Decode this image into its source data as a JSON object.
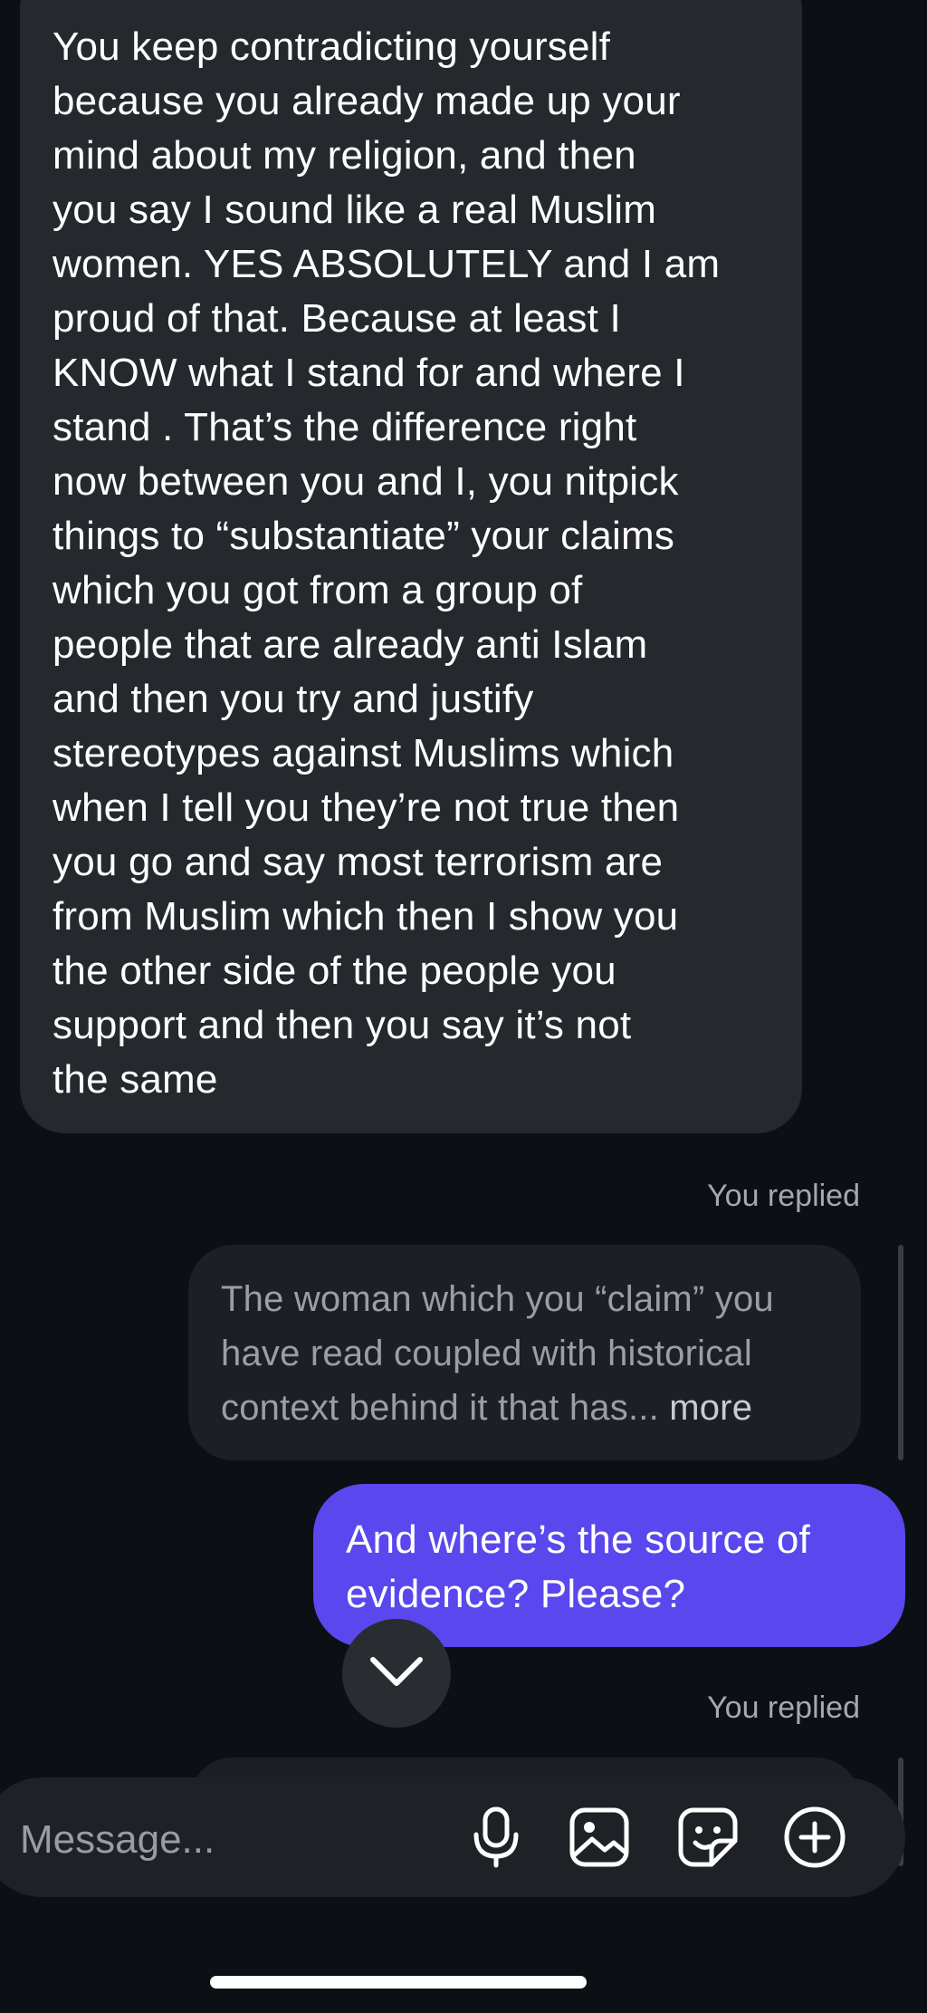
{
  "messages": {
    "received_1": "You keep contradicting yourself\nbecause you already made up your\nmind about my religion, and then\nyou say I sound like a real Muslim\nwomen. YES ABSOLUTELY and I am\nproud of that. Because at least I\nKNOW what I stand for and where I\nstand . That’s the difference right\nnow between you and I, you nitpick\nthings to “substantiate” your claims\nwhich you got from a group of\npeople that are already anti Islam\nand then you try and justify\nstereotypes against Muslims which\nwhen I tell you they’re not true then\nyou go and say most terrorism are\nfrom Muslim which then I show you\nthe other side of the people you\nsupport and then you say it’s not\nthe same",
    "replied_label_1": "You replied",
    "quoted_1": "The woman which you “claim” you\nhave read coupled with historical\ncontext behind it that has... ",
    "quoted_more": "more",
    "sent_1": "And where’s the source of\nevidence? Please?",
    "replied_label_2": "You replied"
  },
  "composer": {
    "placeholder": "Message...",
    "icons": [
      "microphone-icon",
      "image-icon",
      "sticker-icon",
      "plus-circle-icon"
    ]
  },
  "icons": {
    "scroll_down": "chevron-down-icon"
  },
  "colors": {
    "background": "#0c0f14",
    "received_bubble": "#25282d",
    "quoted_bubble": "#1c1f24",
    "sent_bubble": "#5a47ee",
    "secondary_text": "#a6a8ad"
  }
}
